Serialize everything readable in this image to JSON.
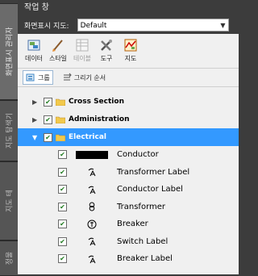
{
  "side_tabs": [
    {
      "label": "화면표시 관리자",
      "active": true
    },
    {
      "label": "지도 탐색기",
      "active": false
    },
    {
      "label": "지도 테",
      "active": false
    },
    {
      "label": "정울",
      "active": false
    }
  ],
  "panel": {
    "title": "작업 창",
    "map_label": "화면표시 지도:",
    "map_value": "Default"
  },
  "toolbar": {
    "items": [
      {
        "label": "데이터",
        "icon": "data-icon",
        "disabled": false
      },
      {
        "label": "스타일",
        "icon": "style-brush-icon",
        "disabled": false
      },
      {
        "label": "테이블",
        "icon": "table-icon",
        "disabled": true
      },
      {
        "label": "도구",
        "icon": "tools-icon",
        "disabled": false
      },
      {
        "label": "지도",
        "icon": "map-icon",
        "disabled": false
      }
    ]
  },
  "subtabs": [
    {
      "label": "그룹",
      "icon": "group-icon",
      "active": true
    },
    {
      "label": "그리기 순서",
      "icon": "draw-order-icon",
      "active": false
    }
  ],
  "tree": {
    "groups": [
      {
        "label": "Cross Section",
        "expanded": false,
        "checked": true,
        "selected": false
      },
      {
        "label": "Administration",
        "expanded": false,
        "checked": true,
        "selected": false
      },
      {
        "label": "Electrical",
        "expanded": true,
        "checked": true,
        "selected": true
      }
    ],
    "layers": [
      {
        "label": "Conductor",
        "checked": true,
        "symbol": "black-bar-icon"
      },
      {
        "label": "Transformer Label",
        "checked": true,
        "symbol": "label-a-icon"
      },
      {
        "label": "Conductor Label",
        "checked": true,
        "symbol": "label-a-icon"
      },
      {
        "label": "Transformer",
        "checked": true,
        "symbol": "transformer-symbol-icon"
      },
      {
        "label": "Breaker",
        "checked": true,
        "symbol": "breaker-symbol-icon"
      },
      {
        "label": "Switch Label",
        "checked": true,
        "symbol": "label-a-icon"
      },
      {
        "label": "Breaker Label",
        "checked": true,
        "symbol": "label-a-icon"
      }
    ]
  },
  "colors": {
    "selection": "#3399ff",
    "folder": "#f2c94c",
    "check": "#1f7a1f"
  }
}
